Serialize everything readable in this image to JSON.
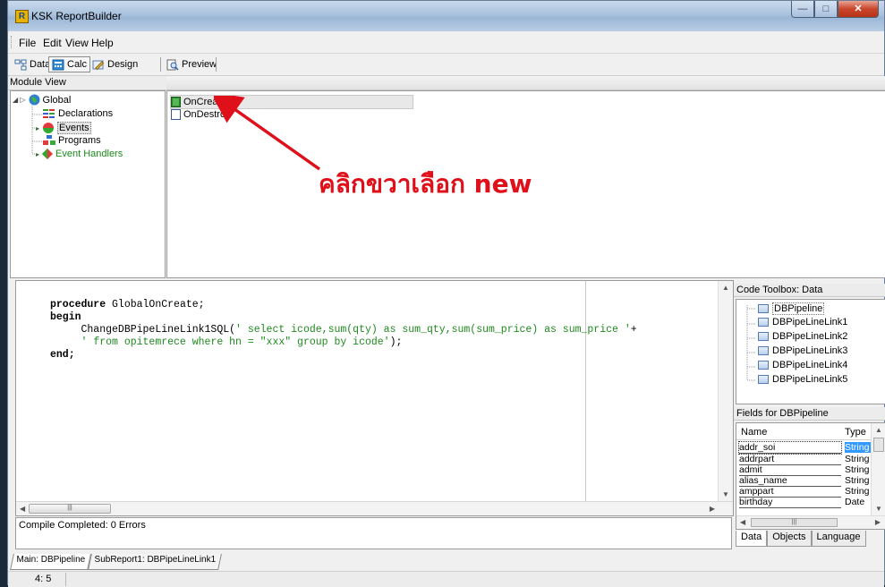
{
  "window": {
    "title": "KSK ReportBuilder",
    "app_icon_letter": "R",
    "caption_buttons": {
      "minimize": "—",
      "maximize": "□",
      "close": "✕"
    }
  },
  "menu": [
    "File",
    "Edit",
    "View",
    "Help"
  ],
  "toolbar": [
    {
      "label": "Data",
      "icon": "data-icon",
      "active": false
    },
    {
      "label": "Calc",
      "icon": "calc-icon",
      "active": true
    },
    {
      "label": "Design",
      "icon": "design-icon",
      "active": false
    },
    {
      "label": "Preview",
      "icon": "preview-icon",
      "active": false
    }
  ],
  "module_view": {
    "header": "Module View",
    "tree": [
      {
        "label": "Global",
        "icon": "globe-icon",
        "level": 0,
        "expanded": true
      },
      {
        "label": "Declarations",
        "icon": "declarations-icon",
        "level": 1
      },
      {
        "label": "Events",
        "icon": "events-icon",
        "level": 1,
        "selected": true
      },
      {
        "label": "Programs",
        "icon": "programs-icon",
        "level": 1
      },
      {
        "label": "Event Handlers",
        "icon": "event-handlers-icon",
        "level": 0,
        "color": "#1a8a1a"
      }
    ]
  },
  "events_list": [
    {
      "label": "OnCreate",
      "icon": "event-filled-icon",
      "selected": true
    },
    {
      "label": "OnDestroy",
      "icon": "event-empty-icon",
      "selected": false
    }
  ],
  "annotation": {
    "text": "คลิกขวาเลือก new",
    "color": "#e0101a"
  },
  "code": {
    "line1_kw": "procedure",
    "line1_rest": " GlobalOnCreate;",
    "line2_kw": "begin",
    "line3_call": "     ChangeDBPipeLineLink1SQL(",
    "line3_str": "' select icode,sum(qty) as sum_qty,sum(sum_price) as sum_price '",
    "line3_tail": "+",
    "line4_pad": "     ",
    "line4_str": "' from opitemrece where hn = \"xxx\" group by icode'",
    "line4_tail": ");",
    "line5_kw": "end;"
  },
  "compile_status": "Compile Completed: 0 Errors",
  "code_toolbox": {
    "header": "Code Toolbox: Data",
    "items": [
      "DBPipeline",
      "DBPipeLineLink1",
      "DBPipeLineLink2",
      "DBPipeLineLink3",
      "DBPipeLineLink4",
      "DBPipeLineLink5"
    ]
  },
  "fields": {
    "header": "Fields for DBPipeline",
    "col_name": "Name",
    "col_type": "Type",
    "rows": [
      {
        "name": "addr_soi",
        "type": "String",
        "selected": true
      },
      {
        "name": "addrpart",
        "type": "String"
      },
      {
        "name": "admit",
        "type": "String"
      },
      {
        "name": "alias_name",
        "type": "String"
      },
      {
        "name": "amppart",
        "type": "String"
      },
      {
        "name": "birthday",
        "type": "Date"
      }
    ]
  },
  "panel_tabs": [
    "Data",
    "Objects",
    "Language"
  ],
  "bottom_tabs": [
    "Main: DBPipeline",
    "SubReport1: DBPipeLineLink1"
  ],
  "cursor_pos": "4: 5"
}
